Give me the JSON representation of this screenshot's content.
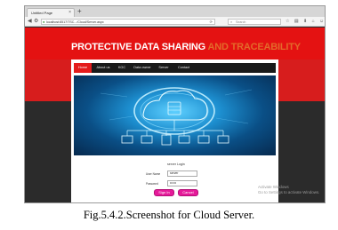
{
  "browser": {
    "tab_title": "Untitled Page",
    "tab_close": "×",
    "new_tab": "+",
    "url": "localhost:8517/TSC.../Cloud/Server.aspx",
    "search_placeholder": "Search"
  },
  "site": {
    "title_part1": "PROTECTIVE DATA SHARING",
    "title_part2": "AND TRACEABILITY"
  },
  "menu": {
    "items": [
      "Home",
      "About us",
      "KGC",
      "Data owner",
      "Server",
      "Contact"
    ]
  },
  "login": {
    "title": "server Login",
    "username_label": "User Name",
    "username_value": "server",
    "password_label": "Password",
    "password_value": "••••••",
    "login_button": "Sign In",
    "cancel_button": "Cancel"
  },
  "watermark": {
    "line1": "Activate Windows",
    "line2": "Go to Settings to activate Windows."
  },
  "caption": "Fig.5.4.2.Screenshot for Cloud Server.",
  "colors": {
    "header_red": "#e41212",
    "title_accent": "#e36a2a",
    "button_pink": "#e51a9a"
  }
}
